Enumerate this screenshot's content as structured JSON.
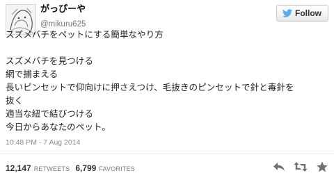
{
  "user": {
    "display_name": "がっぴーや",
    "screen_name": "@mikuru625"
  },
  "follow_button": {
    "label": "Follow",
    "icon": "twitter-bird-icon"
  },
  "tweet": {
    "lines": [
      "スズメバチをペットにする簡単なやり方",
      "",
      "スズメバチを見つける",
      "網で捕まえる",
      "長いピンセットで仰向けに押さえつけ、毛抜きのピンセットで針と毒針を",
      "抜く",
      "適当な紐で結びつける",
      "今日からあなたのペット。"
    ]
  },
  "timestamp": "10:48 PM - 7 Aug 2014",
  "stats": {
    "retweets_count": "12,147",
    "retweets_label": "RETWEETS",
    "favorites_count": "6,799",
    "favorites_label": "FAVORITES"
  },
  "actions": {
    "reply_icon": "reply-icon",
    "retweet_icon": "retweet-icon",
    "favorite_icon": "star-icon"
  },
  "colors": {
    "twitter_blue": "#55acee",
    "icon_gray": "#707070"
  }
}
